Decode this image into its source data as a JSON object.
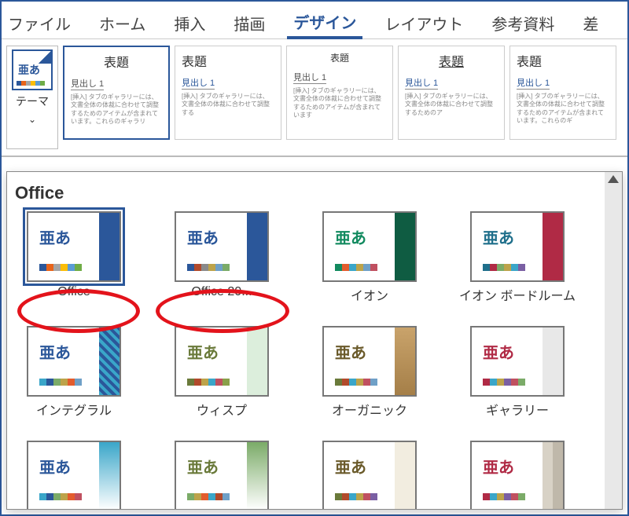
{
  "tabs": {
    "file": "ファイル",
    "home": "ホーム",
    "insert": "挿入",
    "draw": "描画",
    "design": "デザイン",
    "layout": "レイアウト",
    "references": "参考資料",
    "extra": "差"
  },
  "ribbon": {
    "themes_button": {
      "label": "テーマ",
      "icon_text": "亜あ"
    },
    "doc_previews": [
      {
        "title": "表題",
        "heading": "見出し 1",
        "body": "[挿入] タブのギャラリーには、文書全体の体裁に合わせて調整するためのアイテムが含まれています。これらのギャラリ"
      },
      {
        "title": "表題",
        "heading": "見出し 1",
        "body": "[挿入] タブのギャラリーには、文書全体の体裁に合わせて調整する"
      },
      {
        "title": "表題",
        "heading": "見出し 1",
        "body": "[挿入] タブのギャラリーには、文書全体の体裁に合わせて調整するためのアイテムが含まれています"
      },
      {
        "title": "表題",
        "heading": "見出し 1",
        "body": "[挿入] タブのギャラリーには、文書全体の体裁に合わせて調整するためのア"
      },
      {
        "title": "表題",
        "heading": "見出し 1",
        "body": "[挿入] タブのギャラリーには、文書全体の体裁に合わせて調整するためのアイテムが含まれています。これらのギ"
      }
    ]
  },
  "dropdown": {
    "section_title": "Office",
    "themes": [
      {
        "name": "Office",
        "text_color": "#2b579a",
        "accent": "#2b579a",
        "palette": [
          "#2b579a",
          "#e8641b",
          "#a5a5a5",
          "#fbbd09",
          "#5a9bd5",
          "#6fac46"
        ]
      },
      {
        "name": "Office 20...",
        "text_color": "#2b579a",
        "accent": "#2b579a",
        "palette": [
          "#2b579a",
          "#b24a2b",
          "#8a8a8a",
          "#bda34a",
          "#6fa0c7",
          "#7bab68"
        ]
      },
      {
        "name": "イオン",
        "text_color": "#128a5f",
        "accent": "#0f5c42",
        "palette": [
          "#128a5f",
          "#e35c2d",
          "#3aa6c9",
          "#bda34a",
          "#6fa0c7",
          "#c05060"
        ]
      },
      {
        "name": "イオン ボードルーム",
        "text_color": "#1f6f8b",
        "accent": "#b02a45",
        "palette": [
          "#1f6f8b",
          "#b02a45",
          "#7bab68",
          "#bda34a",
          "#3aa6c9",
          "#7a5fa3"
        ]
      },
      {
        "name": "インテグラル",
        "text_color": "#2b579a",
        "accent_pattern": true,
        "palette": [
          "#3aa6c9",
          "#2b579a",
          "#7bab68",
          "#bda34a",
          "#e35c2d",
          "#6fa0c7"
        ]
      },
      {
        "name": "ウィスプ",
        "text_color": "#6a7a3a",
        "accent": "#dceedc",
        "palette": [
          "#6a7a3a",
          "#b24a2b",
          "#bda34a",
          "#3aa6c9",
          "#c05060",
          "#8aa04a"
        ]
      },
      {
        "name": "オーガニック",
        "text_color": "#6a5a2a",
        "accent_wood": true,
        "palette": [
          "#6a7a3a",
          "#b24a2b",
          "#3aa6c9",
          "#bda34a",
          "#c05060",
          "#6fa0c7"
        ]
      },
      {
        "name": "ギャラリー",
        "text_color": "#b02a45",
        "accent": "#e8e8e8",
        "palette": [
          "#b02a45",
          "#3aa6c9",
          "#bda34a",
          "#7a5fa3",
          "#c05060",
          "#7bab68"
        ]
      },
      {
        "name": "",
        "text_color": "#2b579a",
        "accent_blue": true,
        "palette": [
          "#3aa6c9",
          "#2b579a",
          "#7bab68",
          "#bda34a",
          "#e35c2d",
          "#c05060"
        ]
      },
      {
        "name": "",
        "text_color": "#6a7a3a",
        "accent_green": true,
        "palette": [
          "#7bab68",
          "#bda34a",
          "#e35c2d",
          "#3aa6c9",
          "#b24a2b",
          "#6fa0c7"
        ]
      },
      {
        "name": "",
        "text_color": "#6a5a2a",
        "accent": "#f2ede0",
        "palette": [
          "#6a7a3a",
          "#b24a2b",
          "#3aa6c9",
          "#bda34a",
          "#c05060",
          "#7a5fa3"
        ]
      },
      {
        "name": "",
        "text_color": "#b02a45",
        "accent_walls": true,
        "palette": [
          "#b02a45",
          "#3aa6c9",
          "#bda34a",
          "#7a5fa3",
          "#c05060",
          "#7bab68"
        ]
      }
    ],
    "sample_text": "亜あ"
  }
}
